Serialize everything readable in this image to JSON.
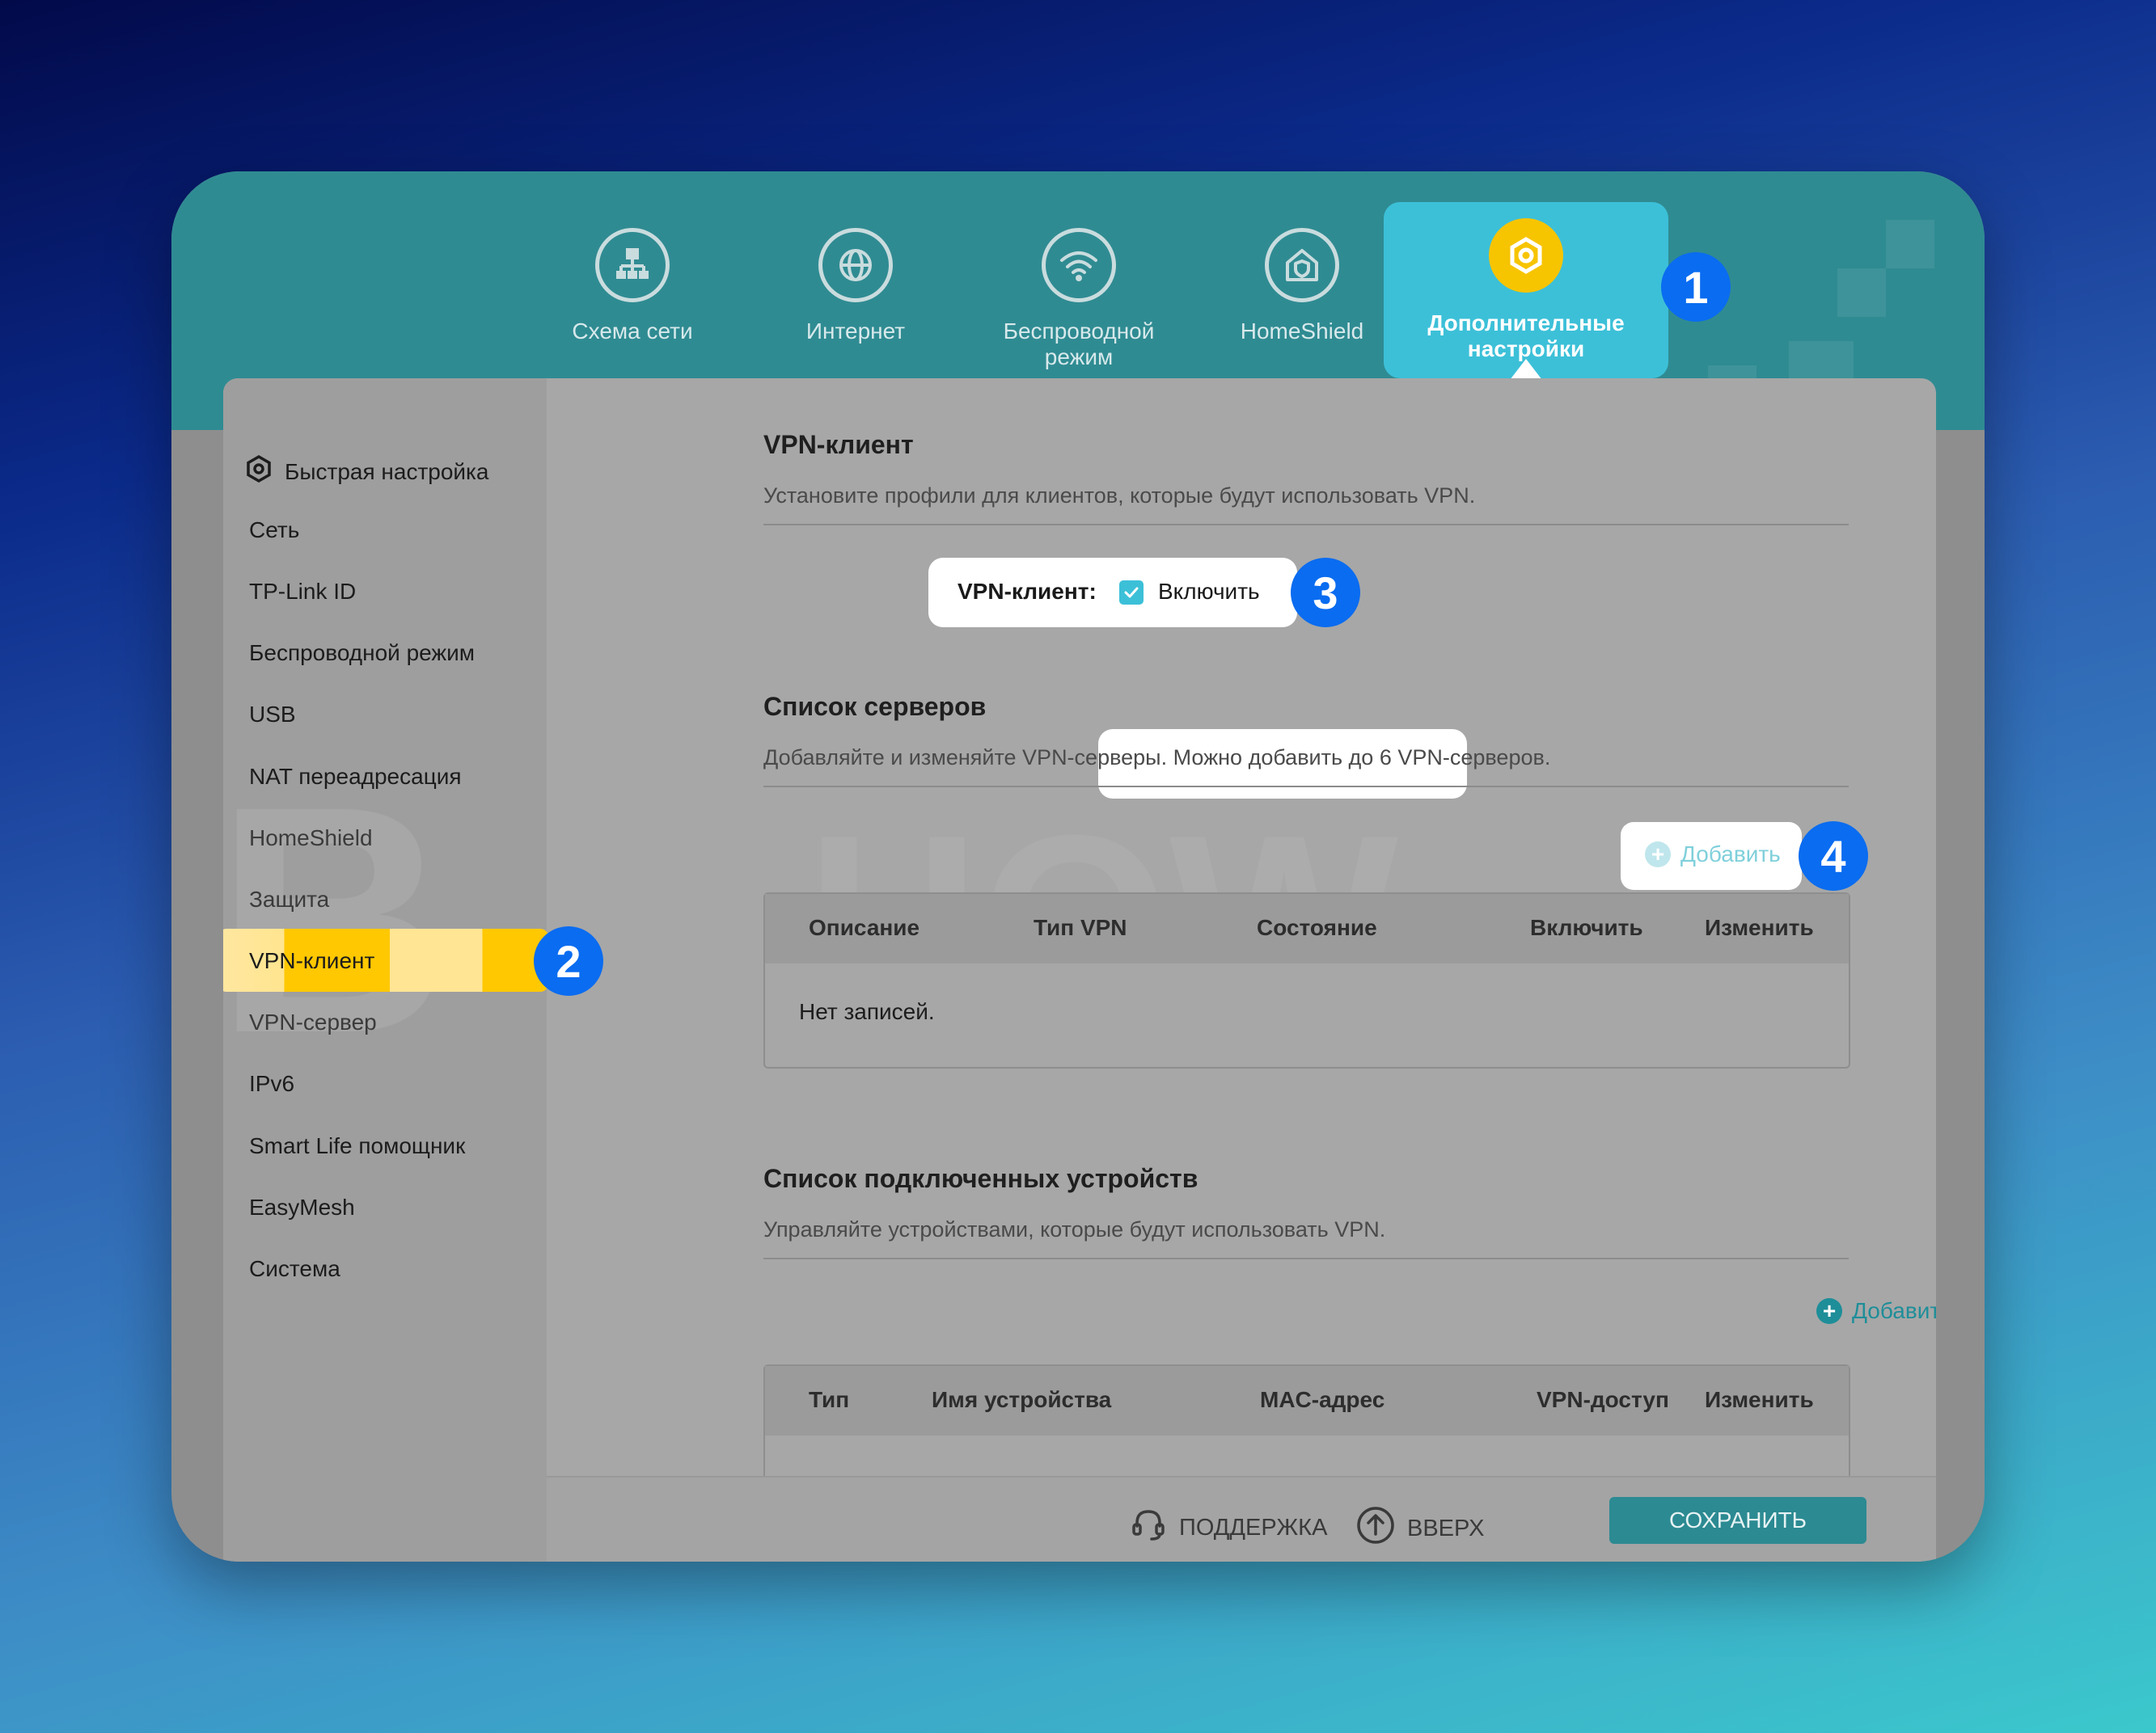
{
  "colors": {
    "teal": "#2f8b92",
    "active_tab": "#3cc0d8",
    "highlight": "#ffc800",
    "badge": "#0a6cf0"
  },
  "top_nav": {
    "items": [
      {
        "label": "Схема сети",
        "icon": "network-map-icon"
      },
      {
        "label": "Интернет",
        "icon": "globe-icon"
      },
      {
        "label": "Беспроводной\nрежим",
        "icon": "wifi-icon"
      },
      {
        "label": "HomeShield",
        "icon": "home-shield-icon"
      }
    ],
    "active": {
      "label": "Дополнительные\nнастройки",
      "icon": "gear-icon"
    }
  },
  "sidebar": {
    "items": [
      {
        "label": "Быстрая настройка",
        "icon": "gear-icon"
      },
      {
        "label": "Сеть"
      },
      {
        "label": "TP-Link ID"
      },
      {
        "label": "Беспроводной режим"
      },
      {
        "label": "USB"
      },
      {
        "label": "NAT переадресация"
      },
      {
        "label": "HomeShield"
      },
      {
        "label": "Защита"
      },
      {
        "label": "VPN-клиент",
        "active": true
      },
      {
        "label": "VPN-сервер"
      },
      {
        "label": "IPv6"
      },
      {
        "label": "Smart Life помощник"
      },
      {
        "label": "EasyMesh"
      },
      {
        "label": "Система"
      }
    ]
  },
  "vpn_client": {
    "title": "VPN-клиент",
    "description": "Установите профили для клиентов, которые будут использовать VPN.",
    "toggle_label": "VPN-клиент:",
    "toggle_text": "Включить",
    "enabled": true
  },
  "server_list": {
    "title": "Список серверов",
    "description": "Добавляйте и изменяйте VPN-серверы. Можно добавить до 6 VPN-серверов.",
    "add_label": "Добавить",
    "columns": [
      "Описание",
      "Тип VPN",
      "Состояние",
      "Включить",
      "Изменить"
    ],
    "empty_text": "Нет записей."
  },
  "devices_list": {
    "title": "Список подключенных устройств",
    "description": "Управляйте устройствами, которые будут использовать VPN.",
    "add_label": "Добавить",
    "columns": [
      "Тип",
      "Имя устройства",
      "MAC-адрес",
      "VPN-доступ",
      "Изменить"
    ]
  },
  "footer": {
    "support": "ПОДДЕРЖКА",
    "up": "ВВЕРХ",
    "save": "СОХРАНИТЬ"
  },
  "step_badges": [
    "1",
    "2",
    "3",
    "4"
  ]
}
